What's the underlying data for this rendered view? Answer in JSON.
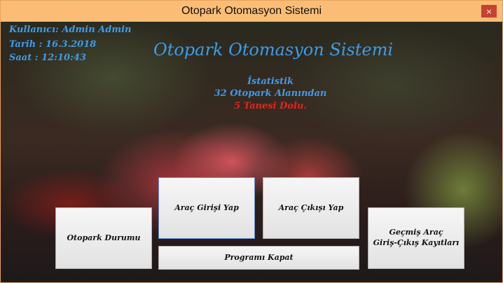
{
  "window": {
    "title": "Otopark Otomasyon Sistemi",
    "close_glyph": "×"
  },
  "info": {
    "user": "Kullanıcı: Admin Admin",
    "date": "Tarih : 16.3.2018",
    "time": "Saat : 12:10:43"
  },
  "heading": "Otopark Otomasyon Sistemi",
  "stats": {
    "title": "İstatistik",
    "capacity": "32 Otopark Alanından",
    "occupied": "5 Tanesi Dolu."
  },
  "buttons": {
    "vehicle_entry": "Araç Girişi Yap",
    "vehicle_exit": "Araç Çıkışı Yap",
    "parking_status": "Otopark Durumu",
    "history_line1": "Geçmiş Araç",
    "history_line2": "Giriş-Çıkış Kayıtları",
    "close_program": "Programı Kapat"
  },
  "colors": {
    "info_blue": "#3f9bea",
    "alert_red": "#e8241c",
    "titlebar": "#fbbd76",
    "close_red": "#c8402e"
  }
}
